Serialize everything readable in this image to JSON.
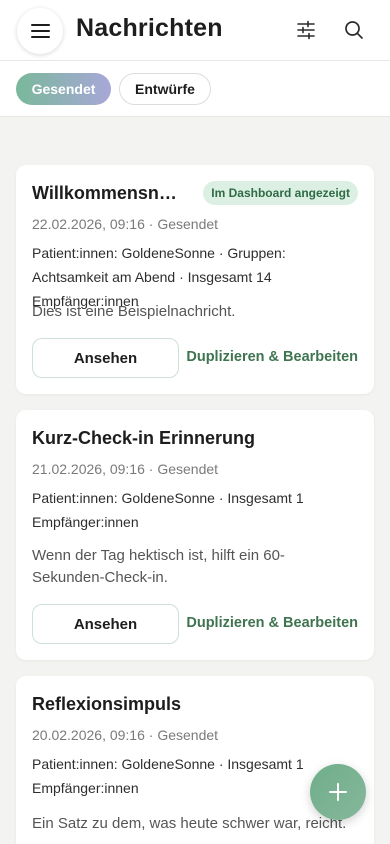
{
  "header": {
    "title": "Nachrichten",
    "menu_icon": "hamburger-menu-icon",
    "filter_icon": "sliders-filter-icon",
    "search_icon": "search-icon"
  },
  "tabs": [
    {
      "label": "Gesendet",
      "active": true
    },
    {
      "label": "Entwürfe",
      "active": false
    }
  ],
  "messages": [
    {
      "title": "Willkommensnachricht",
      "badge": "Im Dashboard angezeigt",
      "meta": "22.02.2026, 09:16 · Gesendet",
      "recipients": "Patient:innen: GoldeneSonne · Gruppen: Achtsamkeit am Abend · Insgesamt 14 Empfänger:innen",
      "preview": "Dies ist eine Beispielnachricht.",
      "view_label": "Ansehen",
      "duplicate_label": "Duplizieren & Bearbeiten"
    },
    {
      "title": "Kurz-Check-in Erinnerung",
      "meta": "21.02.2026, 09:16 · Gesendet",
      "recipients": "Patient:innen: GoldeneSonne · Insgesamt 1 Empfänger:innen",
      "preview": "Wenn der Tag hektisch ist, hilft ein 60-Sekunden-Check-in.",
      "view_label": "Ansehen",
      "duplicate_label": "Duplizieren & Bearbeiten"
    },
    {
      "title": "Reflexionsimpuls",
      "meta": "20.02.2026, 09:16 · Gesendet",
      "recipients": "Patient:innen: GoldeneSonne · Insgesamt 1 Empfänger:innen",
      "preview": "Ein Satz zu dem, was heute schwer war, reicht."
    }
  ],
  "fab": {
    "icon": "plus-icon"
  },
  "colors": {
    "accent_green": "#3f7450",
    "badge_bg": "#dcefe3",
    "tab_gradient_start": "#79b89a",
    "tab_gradient_end": "#a8a7d8"
  }
}
